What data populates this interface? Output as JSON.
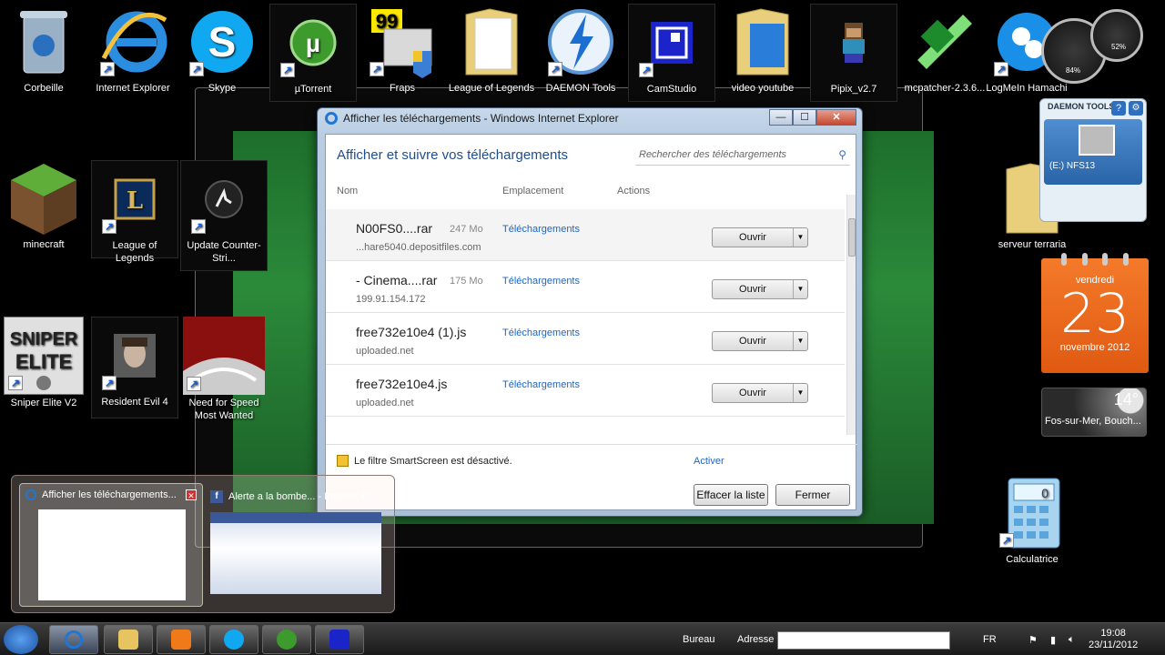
{
  "desktop_icons": [
    {
      "label": "Corbeille",
      "icon": "recycle-bin-icon"
    },
    {
      "label": "Internet Explorer",
      "icon": "internet-explorer-icon"
    },
    {
      "label": "Skype",
      "icon": "skype-icon"
    },
    {
      "label": "µTorrent",
      "icon": "utorrent-icon"
    },
    {
      "label": "Fraps",
      "icon": "fraps-icon",
      "badge": "99"
    },
    {
      "label": "League of Legends",
      "icon": "folder-icon"
    },
    {
      "label": "DAEMON Tools",
      "icon": "daemon-tools-icon"
    },
    {
      "label": "CamStudio",
      "icon": "camstudio-icon"
    },
    {
      "label": "video youtube",
      "icon": "folder-icon"
    },
    {
      "label": "Pipix_v2.7",
      "icon": "pipix-icon"
    },
    {
      "label": "mcpatcher-2.3.6...",
      "icon": "mcpatcher-icon"
    },
    {
      "label": "LogMeIn Hamachi",
      "icon": "hamachi-icon"
    },
    {
      "label": "minecraft",
      "icon": "minecraft-icon"
    },
    {
      "label": "League of Legends",
      "icon": "lol-icon"
    },
    {
      "label": "Update Counter-Stri...",
      "icon": "counter-strike-icon"
    },
    {
      "label": "Sniper Elite V2",
      "icon": "sniper-elite-icon"
    },
    {
      "label": "Resident Evil 4",
      "icon": "resident-evil-icon"
    },
    {
      "label": "Need for Speed Most Wanted",
      "icon": "nfs-icon"
    },
    {
      "label": "serveur terraria",
      "icon": "folder-icon"
    },
    {
      "label": "Calculatrice",
      "icon": "calculator-icon"
    }
  ],
  "dialog": {
    "title": "Afficher les téléchargements - Windows Internet Explorer",
    "heading": "Afficher et suivre vos téléchargements",
    "search_placeholder": "Rechercher des téléchargements",
    "columns": {
      "name": "Nom",
      "location": "Emplacement",
      "actions": "Actions"
    },
    "rows": [
      {
        "name": "N00FS0....rar",
        "size": "247 Mo",
        "source": "...hare5040.depositfiles.com",
        "location": "Téléchargements",
        "action": "Ouvrir"
      },
      {
        "name": "- Cinema....rar",
        "size": "175 Mo",
        "source": "199.91.154.172",
        "location": "Téléchargements",
        "action": "Ouvrir"
      },
      {
        "name": "free732e10e4 (1).js",
        "size": "",
        "source": "uploaded.net",
        "location": "Téléchargements",
        "action": "Ouvrir"
      },
      {
        "name": "free732e10e4.js",
        "size": "",
        "source": "uploaded.net",
        "location": "Téléchargements",
        "action": "Ouvrir"
      }
    ],
    "smartscreen": "Le filtre SmartScreen est désactivé.",
    "activate": "Activer",
    "clear_list": "Effacer la liste",
    "close": "Fermer"
  },
  "daemon_gadget": {
    "title": "DAEMON TOOLS",
    "drive": "(E:) NFS13"
  },
  "calendar": {
    "weekday": "vendredi",
    "day": "23",
    "month": "novembre 2012"
  },
  "weather": {
    "temp": "14°",
    "city": "Fos-sur-Mer, Bouch..."
  },
  "gauges": {
    "cpu": "84%",
    "mem": "52%"
  },
  "thumbnails": [
    {
      "title": "Afficher les téléchargements...",
      "icon": "internet-explorer-icon"
    },
    {
      "title": "Alerte a la bombe... - Internet Ex...",
      "icon": "facebook-icon"
    }
  ],
  "taskbar": {
    "bureau": "Bureau",
    "adresse": "Adresse",
    "lang": "FR",
    "time": "19:08",
    "date": "23/11/2012",
    "apps": [
      "internet-explorer",
      "explorer",
      "media-player",
      "skype",
      "utorrent",
      "camstudio"
    ]
  }
}
